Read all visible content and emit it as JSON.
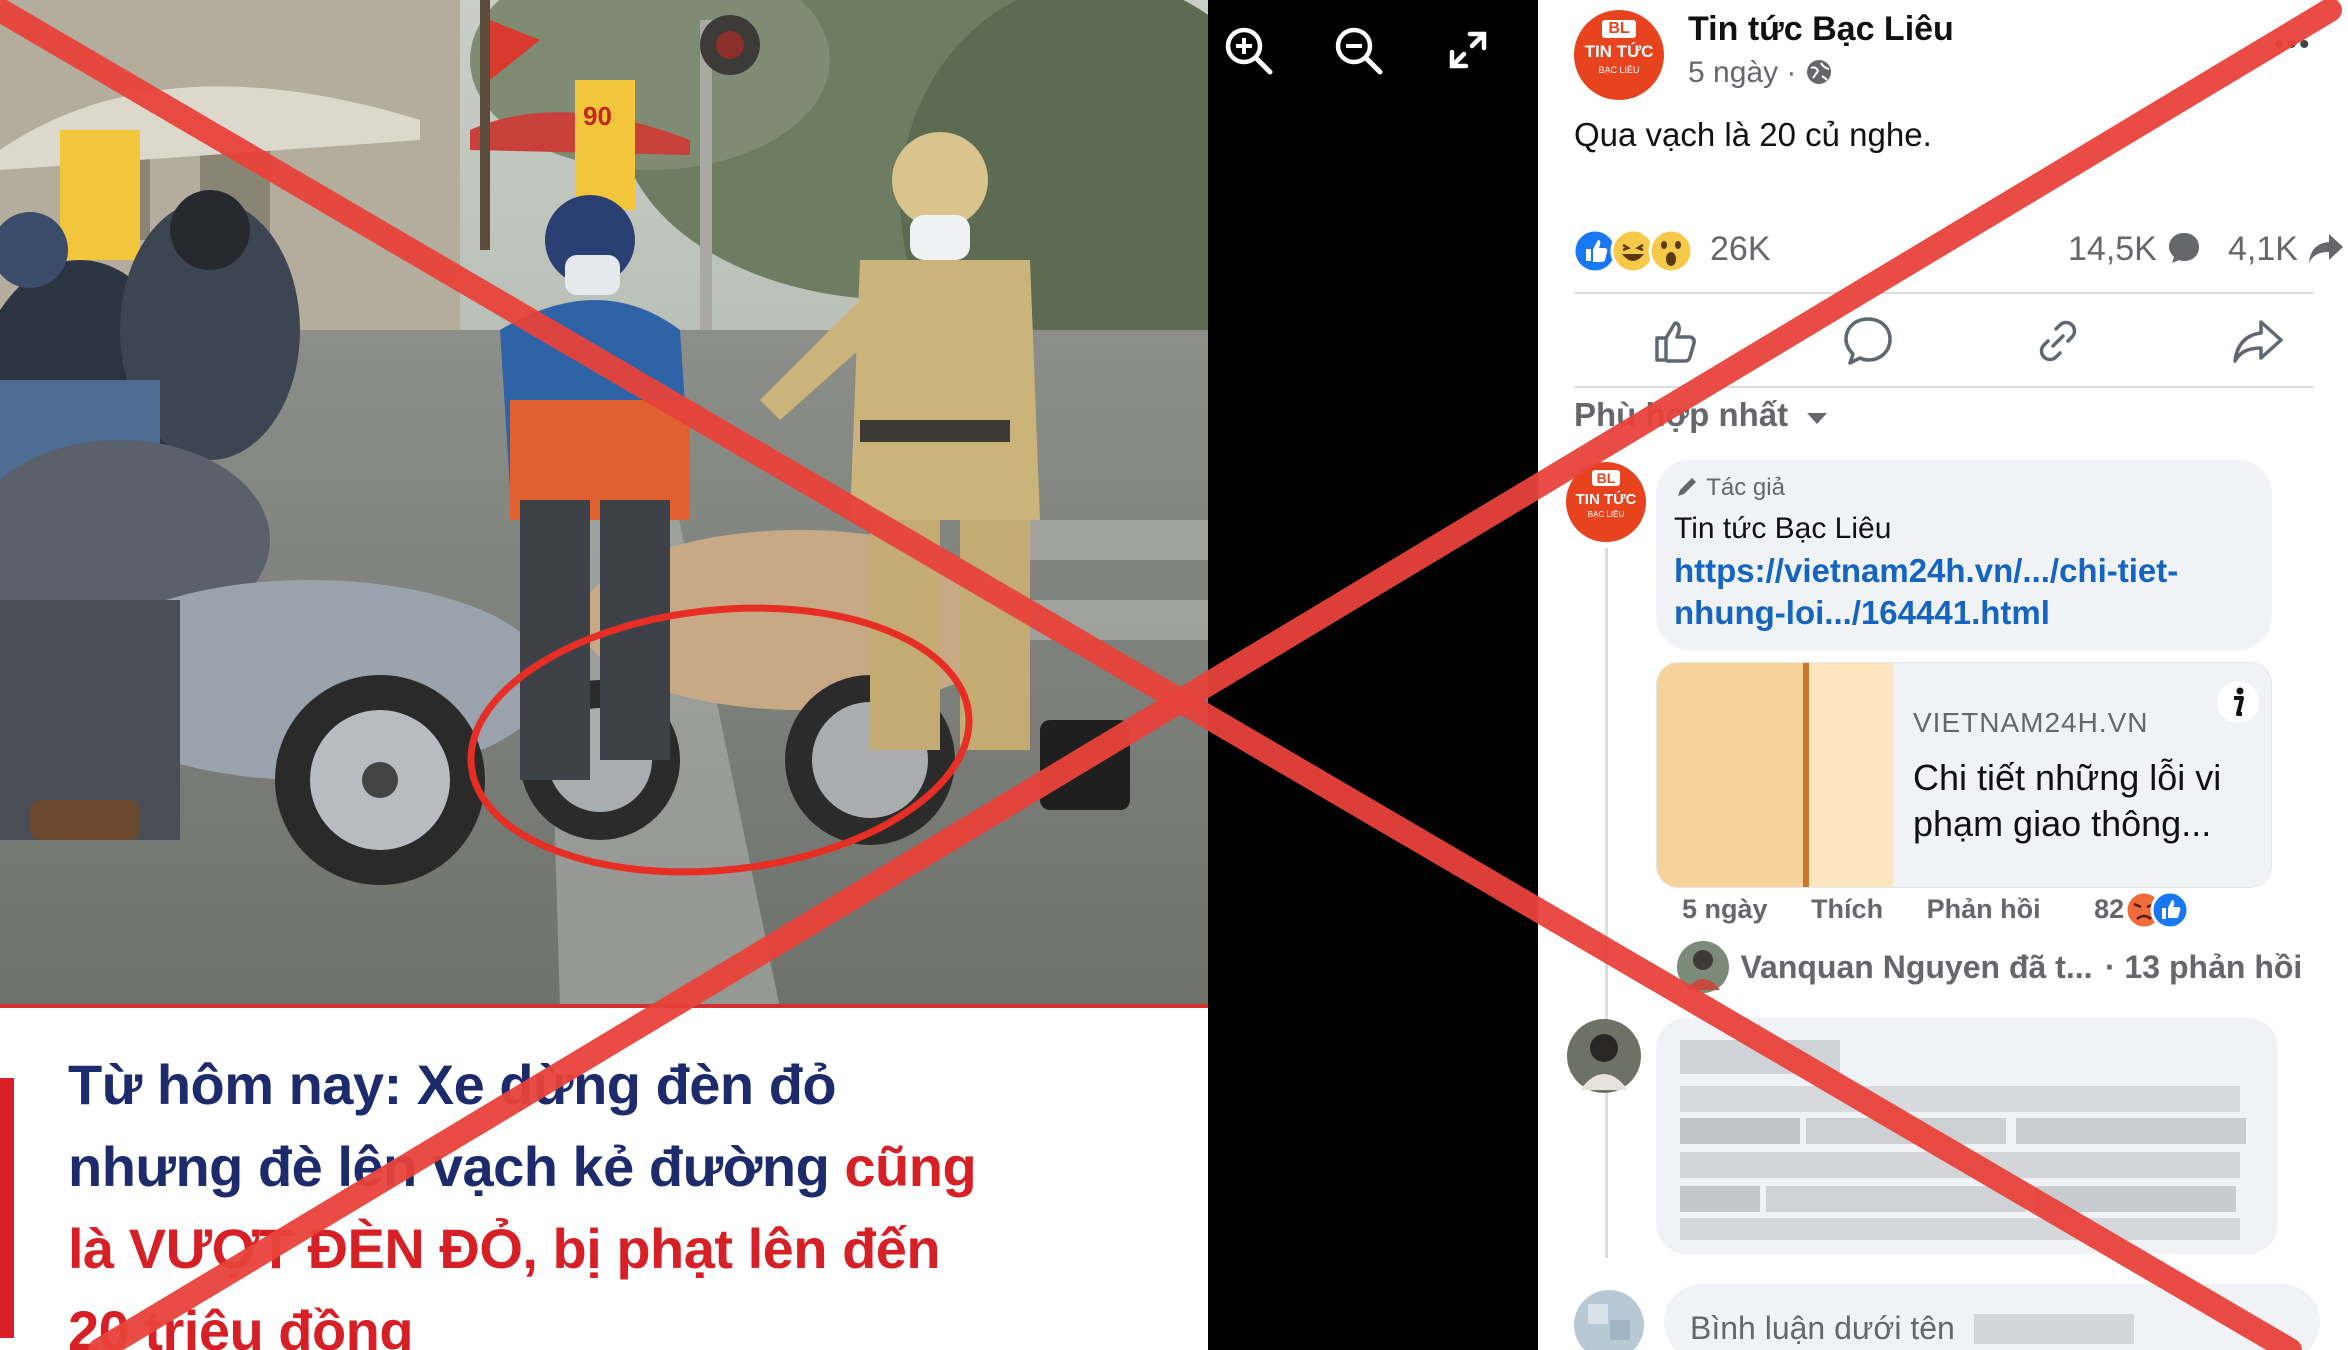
{
  "viewer": {
    "zoom_in_icon": "zoom-in-icon",
    "zoom_out_icon": "zoom-out-icon",
    "fullscreen_icon": "expand-icon"
  },
  "photo": {
    "sign_text": "90",
    "headline": {
      "line1": "Từ hôm nay: Xe dừng đèn đỏ",
      "line2_dark": "nhưng đè lên vạch kẻ đường ",
      "line2_red": "cũng",
      "line3": "là VƯỢT ĐÈN ĐỎ, bị phạt lên đến",
      "line4": "20 triệu đồng"
    }
  },
  "post": {
    "page_name": "Tin tức Bạc Liêu",
    "avatar_text": {
      "top": "BL",
      "middle": "TIN TỨC",
      "bottom": "BẠC LIÊU"
    },
    "time": "5 ngày ·",
    "body": "Qua vạch là 20 củ nghe.",
    "reaction_count": "26K",
    "comment_count": "14,5K",
    "share_count": "4,1K",
    "sort_label": "Phù hợp nhất",
    "author_comment": {
      "badge": "Tác giả",
      "name": "Tin tức Bạc Liêu",
      "link_line1": "https://vietnam24h.vn/.../chi-tiet-",
      "link_line2": "nhung-loi.../164441.html",
      "preview_domain": "VIETNAM24H.VN",
      "preview_title_line1": "Chi tiết những lỗi vi",
      "preview_title_line2": "phạm giao thông...",
      "time": "5 ngày",
      "like": "Thích",
      "reply": "Phản hồi",
      "reaction_count": "82"
    },
    "replies_summary": {
      "text": "Vanquan Nguyen đã t...",
      "count": "· 13 phản hồi"
    },
    "composer_placeholder": "Bình luận dưới tên"
  },
  "colors": {
    "cross": "#e8433a",
    "brand_red": "#e8431f",
    "headline_blue": "#1d2a6b",
    "headline_red": "#d71f26",
    "link": "#1565c0"
  }
}
